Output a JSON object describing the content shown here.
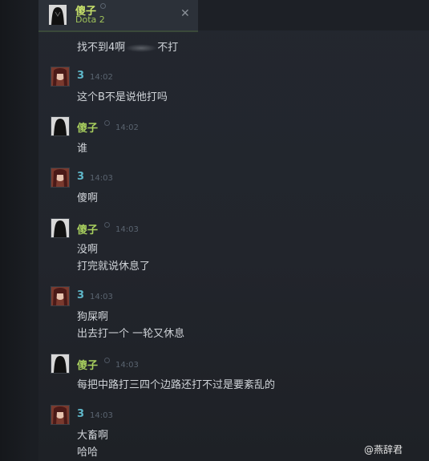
{
  "tab": {
    "name": "傻子",
    "game": "Dota 2",
    "close": "✕"
  },
  "messages": [
    {
      "lines": [
        "找不到4啊",
        "不打"
      ]
    },
    {
      "user": "3",
      "time": "14:02",
      "lines": [
        "这个B不是说他打吗"
      ]
    },
    {
      "user": "傻子",
      "time": "14:02",
      "lines": [
        "谁"
      ]
    },
    {
      "user": "3",
      "time": "14:03",
      "lines": [
        "傻啊"
      ]
    },
    {
      "user": "傻子",
      "time": "14:03",
      "lines": [
        "没啊",
        "打完就说休息了"
      ]
    },
    {
      "user": "3",
      "time": "14:03",
      "lines": [
        "狗屎啊",
        "出去打一个 一轮又休息"
      ]
    },
    {
      "user": "傻子",
      "time": "14:03",
      "lines": [
        "每把中路打三四个边路还打不过是要紊乱的"
      ]
    },
    {
      "user": "3",
      "time": "14:03",
      "lines": [
        "大畜啊",
        "哈哈"
      ]
    }
  ],
  "watermark": "@燕辞君",
  "colors": {
    "name_friend": "#a8cf5e",
    "name_self": "#5fb7c9",
    "text": "#cfd3d8"
  }
}
